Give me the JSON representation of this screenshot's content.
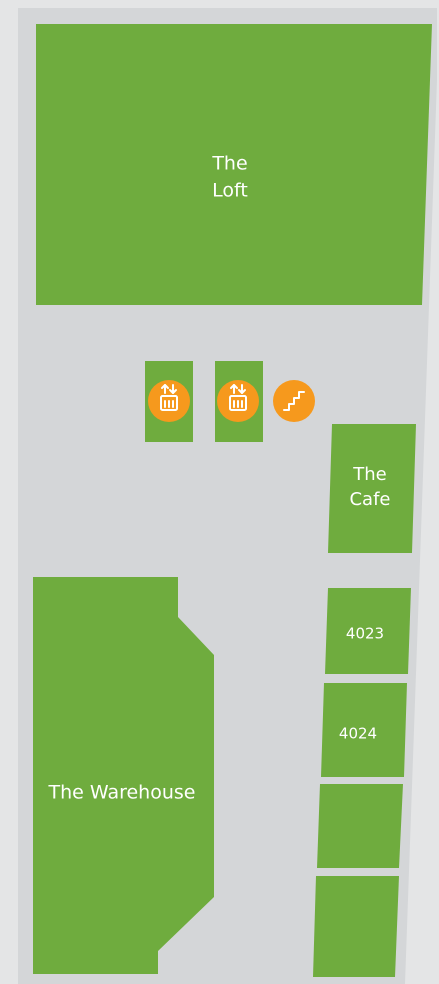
{
  "floor_plan": {
    "colors": {
      "background": "#e4e5e6",
      "floor": "#d4d6d8",
      "room": "#6fac3e",
      "facility_icon": "#f6991d",
      "label": "#ffffff"
    },
    "rooms": {
      "loft": {
        "label_line1": "The",
        "label_line2": "Loft"
      },
      "cafe": {
        "label_line1": "The",
        "label_line2": "Cafe"
      },
      "room_4023": {
        "label": "4023"
      },
      "room_4024": {
        "label": "4024"
      },
      "unlabeled_room_1": {
        "label": ""
      },
      "unlabeled_room_2": {
        "label": ""
      },
      "warehouse": {
        "label": "The Warehouse"
      }
    },
    "facilities": [
      {
        "type": "elevator",
        "icon": "elevator-icon"
      },
      {
        "type": "elevator",
        "icon": "elevator-icon"
      },
      {
        "type": "stairs",
        "icon": "stairs-icon"
      }
    ]
  }
}
